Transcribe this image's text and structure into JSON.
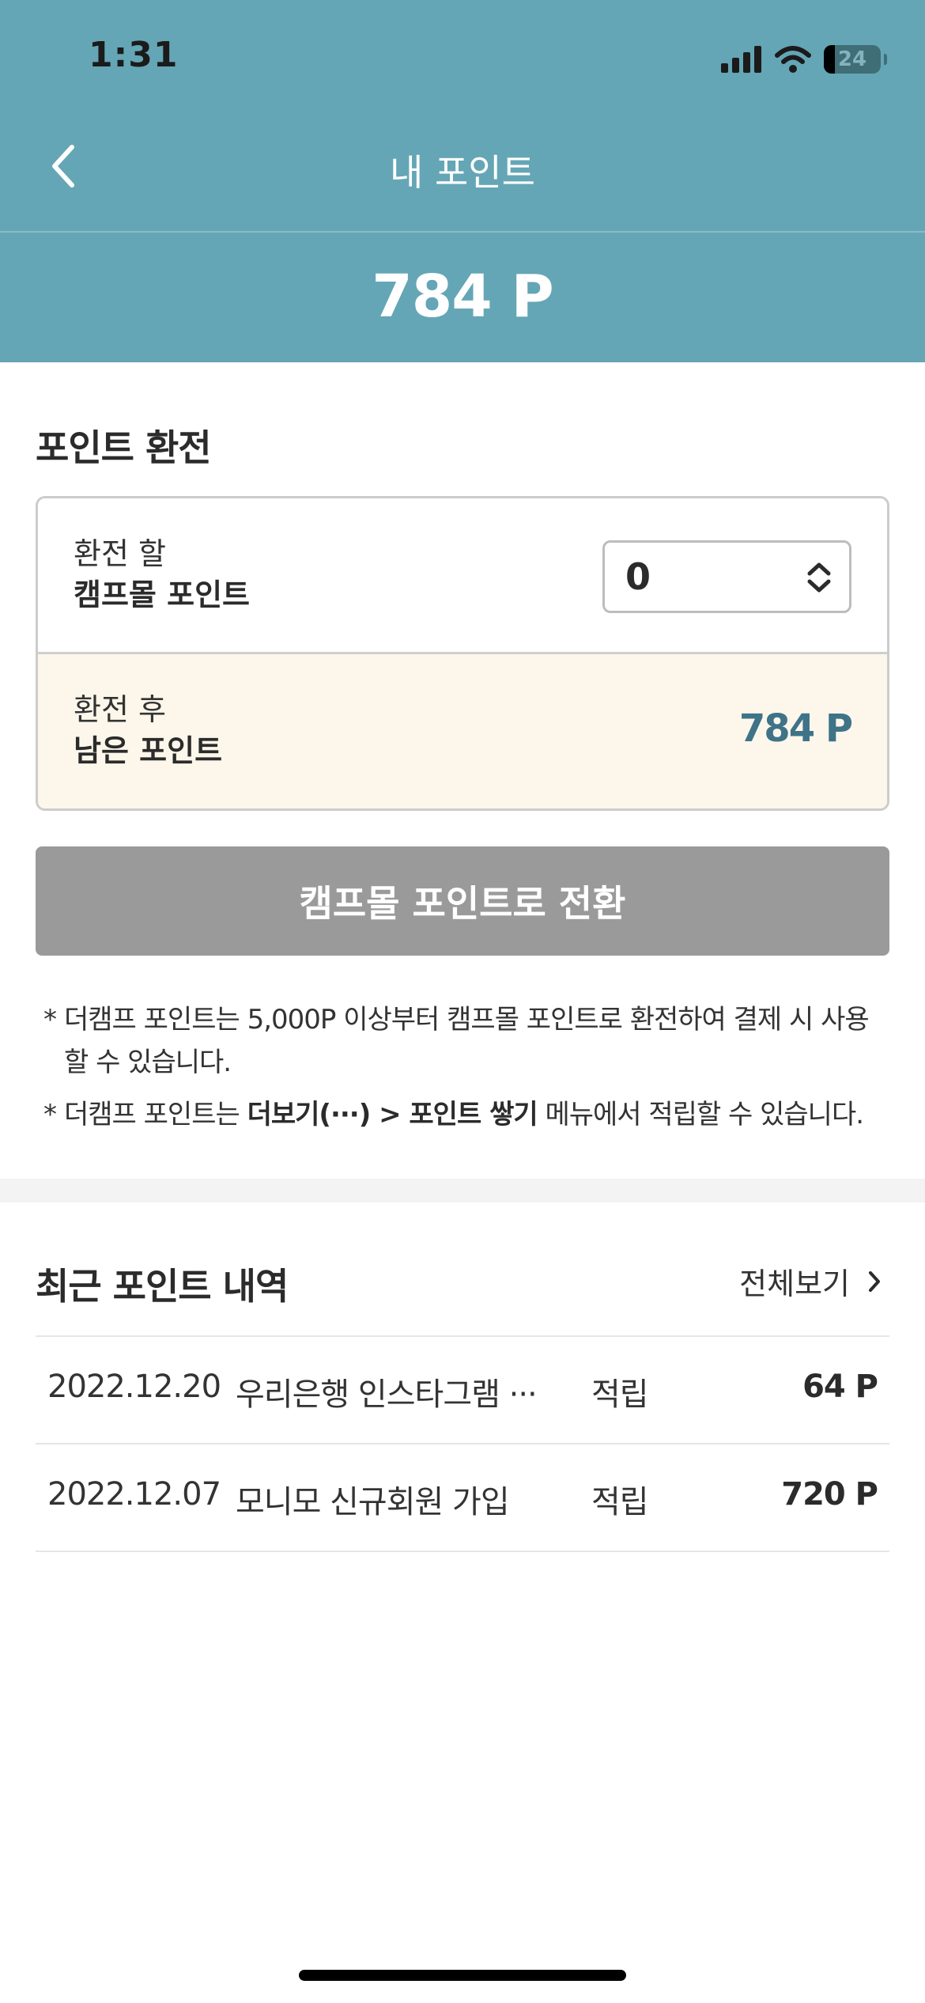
{
  "status_bar": {
    "time": "1:31",
    "battery": "24"
  },
  "header": {
    "title": "내 포인트",
    "total_points": "784 P"
  },
  "exchange": {
    "section_title": "포인트 환전",
    "input_label_line1": "환전 할",
    "input_label_line2": "캠프몰 포인트",
    "input_value": "0",
    "result_label_line1": "환전 후",
    "result_label_line2": "남은 포인트",
    "remaining_points": "784 P",
    "convert_button": "캠프몰 포인트로 전환"
  },
  "notes": {
    "star": "*",
    "note1": "더캠프 포인트는 5,000P 이상부터 캠프몰 포인트로 환전하여 결제 시 사용할 수 있습니다.",
    "note2_pre": "더캠프 포인트는 ",
    "note2_bold": "더보기(···) > 포인트 쌓기",
    "note2_post": " 메뉴에서 적립할 수 있습니다."
  },
  "history": {
    "section_title": "최근 포인트 내역",
    "view_all": "전체보기",
    "items": [
      {
        "date": "2022.12.20",
        "description": "우리은행 인스타그램 ···",
        "type": "적립",
        "points": "64 P"
      },
      {
        "date": "2022.12.07",
        "description": "모니모 신규회원 가입",
        "type": "적립",
        "points": "720 P"
      }
    ]
  },
  "colors": {
    "header_bg": "#64a6b5",
    "accent_points": "#3f7388",
    "button_disabled": "#9a9a9a",
    "result_row_bg": "#fcf7ea"
  },
  "icons": [
    "signal-icon",
    "wifi-icon",
    "battery-icon",
    "back-chevron-icon",
    "stepper-updown-icon",
    "chevron-right-icon"
  ]
}
